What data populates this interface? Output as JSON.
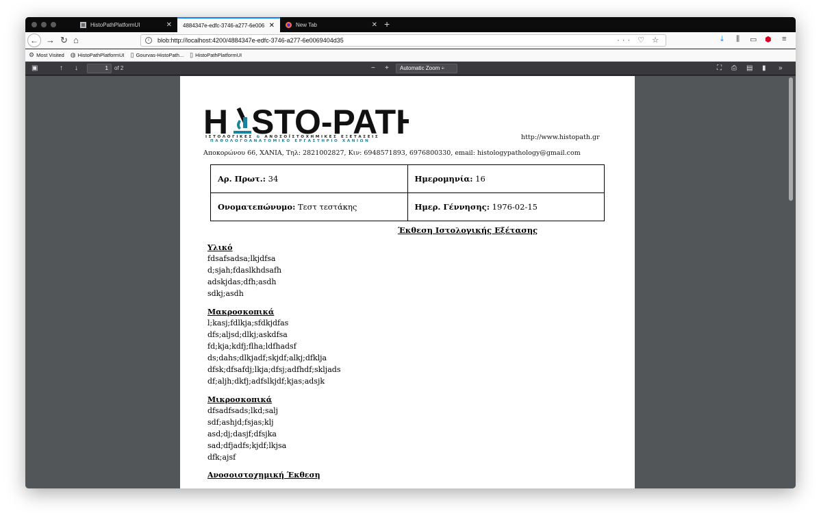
{
  "browser": {
    "tabs": [
      {
        "title": "HistoPathPlatformUI",
        "active": false
      },
      {
        "title": "4884347e-edfc-3746-a277-6e006",
        "active": true
      },
      {
        "title": "New Tab",
        "active": false
      }
    ],
    "url": "blob:http://localhost:4200/4884347e-edfc-3746-a277-6e0069404d35",
    "bookmarks": [
      "Most Visited",
      "HistoPathPlatformUI",
      "Gourvas-HistoPath...",
      "HistoPathPlatformUI"
    ]
  },
  "pdf_toolbar": {
    "page_number": "1",
    "page_count": "of 2",
    "zoom_minus": "−",
    "zoom_plus": "+",
    "zoom": "Automatic Zoom"
  },
  "document": {
    "logo_text_left": "H",
    "logo_text_right": "STO-PATH",
    "tagline_1a": "ΙΣΤΟΛΟΓΙΚΕΣ",
    "tagline_1amp": "&",
    "tagline_1b": "ΑΝΟΣΟΪΣΤΟΧΗΜΙΚΕΣ ΕΞΕΤΑΣΕΙΣ",
    "tagline_2": "ΠΑΘΟΛΟΓΟΑΝΑΤΟΜΙΚΟ ΕΡΓΑΣΤΗΡΙΟ ΧΑΝΙΩΝ",
    "website": "http://www.histopath.gr",
    "address": "Αποκορώνου 66, ΧΑΝΙΑ, Τηλ: 2821002827, Κιν: 6948571893, 6976800330, email: histologypathology@gmail.com",
    "fields": {
      "protocol_label": "Αρ. Πρωτ.:",
      "protocol_value": " 34",
      "date_label": "Ημερομηνία:",
      "date_value": " 16",
      "name_label": "Ονοματεπώνυμο:",
      "name_value": " Τεστ τεστάκης",
      "dob_label": "Ημερ. Γέννησης:",
      "dob_value": " 1976-02-15"
    },
    "report_title": "Έκθεση Ιστολογικής Εξέτασης",
    "sections": [
      {
        "heading": "Υλικό",
        "lines": [
          "fdsafsadsa;lkjdfsa",
          "d;sjah;fdaslkhdsafh",
          "adskjdas;dfh;asdh",
          "sdkj;asdh"
        ]
      },
      {
        "heading": "Μακροσκοπικά",
        "lines": [
          "l;kasj;fdlkja;sfdkjdfas",
          "dfs;aljsd;dlkj;askdfsa",
          "fd;kja;kdfj;flha;ldfhadsf",
          "ds;dahs;dlkjadf;skjdf;alkj;dfklja",
          "dfsk;dfsafdj;lkja;dfsj;adfhdf;skljads",
          "df;aljh;dkfj;adfslkjdf;kjas;adsjk"
        ]
      },
      {
        "heading": "Μικροσκοπικά",
        "lines": [
          "dfsadfsads;lkd;salj",
          "sdf;ashjd;fsjas;klj",
          "asd;dj;dasjf;dfsjka",
          "sad;dfjadfs;kjdf;lkjsa",
          "dfk;ajsf"
        ]
      },
      {
        "heading": "Ανοσοιστοχημική Έκθεση",
        "lines": []
      }
    ]
  }
}
